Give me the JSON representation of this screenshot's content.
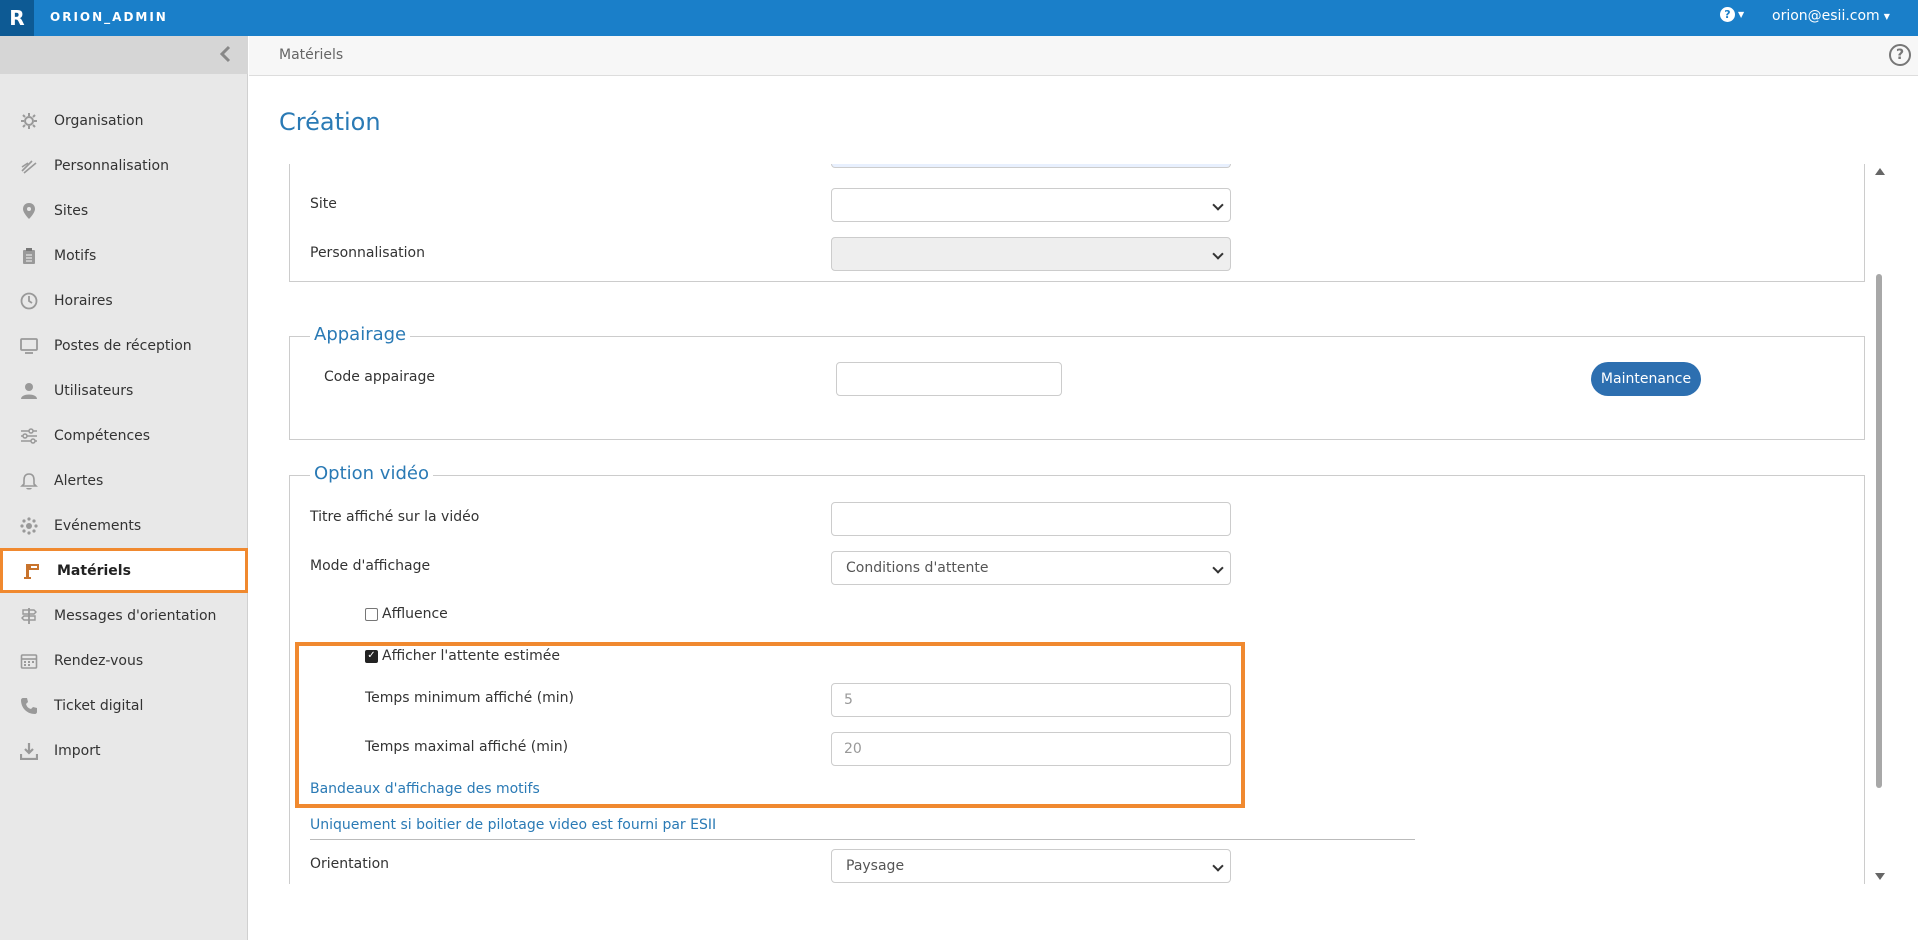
{
  "topbar": {
    "logo": "R",
    "app_title": "ORION_ADMIN",
    "help_glyph": "?",
    "user": "orion@esii.com"
  },
  "sidebar": {
    "items": [
      {
        "label": "Organisation",
        "icon": "gear-icon"
      },
      {
        "label": "Personnalisation",
        "icon": "brush-icon"
      },
      {
        "label": "Sites",
        "icon": "map-pin-icon"
      },
      {
        "label": "Motifs",
        "icon": "clipboard-icon"
      },
      {
        "label": "Horaires",
        "icon": "clock-icon"
      },
      {
        "label": "Postes de réception",
        "icon": "monitor-icon"
      },
      {
        "label": "Utilisateurs",
        "icon": "user-icon"
      },
      {
        "label": "Compétences",
        "icon": "sliders-icon"
      },
      {
        "label": "Alertes",
        "icon": "bell-icon"
      },
      {
        "label": "Evénements",
        "icon": "cog-burst-icon"
      },
      {
        "label": "Matériels",
        "icon": "kiosk-icon",
        "active": true
      },
      {
        "label": "Messages d'orientation",
        "icon": "signpost-icon"
      },
      {
        "label": "Rendez-vous",
        "icon": "calendar-icon"
      },
      {
        "label": "Ticket digital",
        "icon": "phone-icon"
      },
      {
        "label": "Import",
        "icon": "download-icon"
      }
    ]
  },
  "breadcrumb": "Matériels",
  "help_glyph": "?",
  "page_title": "Création",
  "form": {
    "site_label": "Site",
    "site_value": "",
    "personnalisation_label": "Personnalisation",
    "personnalisation_value": "",
    "appairage": {
      "legend": "Appairage",
      "code_label": "Code appairage",
      "code_value": "",
      "maintenance_label": "Maintenance"
    },
    "video": {
      "legend": "Option vidéo",
      "titre_label": "Titre affiché sur la vidéo",
      "titre_value": "",
      "mode_label": "Mode d'affichage",
      "mode_value": "Conditions d'attente",
      "affluence_label": "Affluence",
      "affluence_checked": false,
      "attente_label": "Afficher l'attente estimée",
      "attente_checked": true,
      "tmin_label": "Temps minimum affiché (min)",
      "tmin_placeholder": "5",
      "tmax_label": "Temps maximal affiché (min)",
      "tmax_placeholder": "20",
      "bandeaux_link": "Bandeaux d'affichage des motifs",
      "pilotage_link": "Uniquement si boitier de pilotage video est fourni par ESII",
      "orientation_label": "Orientation",
      "orientation_value": "Paysage"
    }
  },
  "colors": {
    "topbar": "#1a7fc9",
    "accent": "#2a7ab5",
    "highlight": "#f0892f",
    "button": "#2d6fb0"
  }
}
